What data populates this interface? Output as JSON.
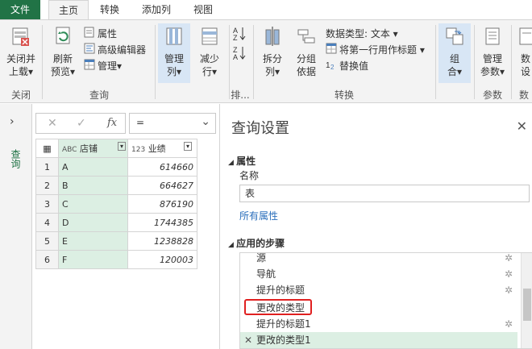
{
  "tabs": [
    "文件",
    "主页",
    "转换",
    "添加列",
    "视图"
  ],
  "ribbon": {
    "close_group": {
      "button": "关闭并上载",
      "button_l1": "关闭并",
      "button_l2": "上载▾",
      "label": "关闭"
    },
    "query_group": {
      "refresh_l1": "刷新",
      "refresh_l2": "预览▾",
      "properties": "属性",
      "advanced_editor": "高级编辑器",
      "manage": "管理▾",
      "label": "查询"
    },
    "manage_cols": {
      "l1": "管理",
      "l2": "列▾"
    },
    "reduce_rows": {
      "l1": "减少",
      "l2": "行▾"
    },
    "sort_label": "排...",
    "transform_group": {
      "split_l1": "拆分",
      "split_l2": "列▾",
      "group_l1": "分组",
      "group_l2": "依据",
      "datatype": "数据类型: 文本 ▾",
      "first_row_header": "将第一行用作标题 ▾",
      "replace_values": "替换值",
      "label": "转换"
    },
    "combine": {
      "l1": "组",
      "l2": "合▾"
    },
    "params": {
      "l1": "管理",
      "l2": "参数▾",
      "label": "参数"
    },
    "data_source": {
      "l1": "数",
      "l2": "设",
      "label": "数"
    }
  },
  "left_pane_label": "查询",
  "formula_bar": {
    "cancel": "✕",
    "confirm": "✓",
    "fx": "fx",
    "value": "="
  },
  "table": {
    "headers": [
      {
        "type": "ABC",
        "name": "店铺"
      },
      {
        "type": "123",
        "name": "业绩"
      }
    ],
    "rows": [
      {
        "n": "1",
        "shop": "A",
        "sales": "614660"
      },
      {
        "n": "2",
        "shop": "B",
        "sales": "664627"
      },
      {
        "n": "3",
        "shop": "C",
        "sales": "876190"
      },
      {
        "n": "4",
        "shop": "D",
        "sales": "1744385"
      },
      {
        "n": "5",
        "shop": "E",
        "sales": "1238828"
      },
      {
        "n": "6",
        "shop": "F",
        "sales": "120003"
      }
    ]
  },
  "settings": {
    "title": "查询设置",
    "properties_section": "属性",
    "name_label": "名称",
    "name_value": "表",
    "all_properties": "所有属性",
    "steps_section": "应用的步骤",
    "steps": [
      "源",
      "导航",
      "提升的标题",
      "更改的类型",
      "提升的标题1",
      "更改的类型1"
    ]
  },
  "colors": {
    "file_tab": "#217346",
    "selected_fill": "#dcefe3",
    "highlight": "#e02020",
    "link": "#2a6ebb"
  }
}
